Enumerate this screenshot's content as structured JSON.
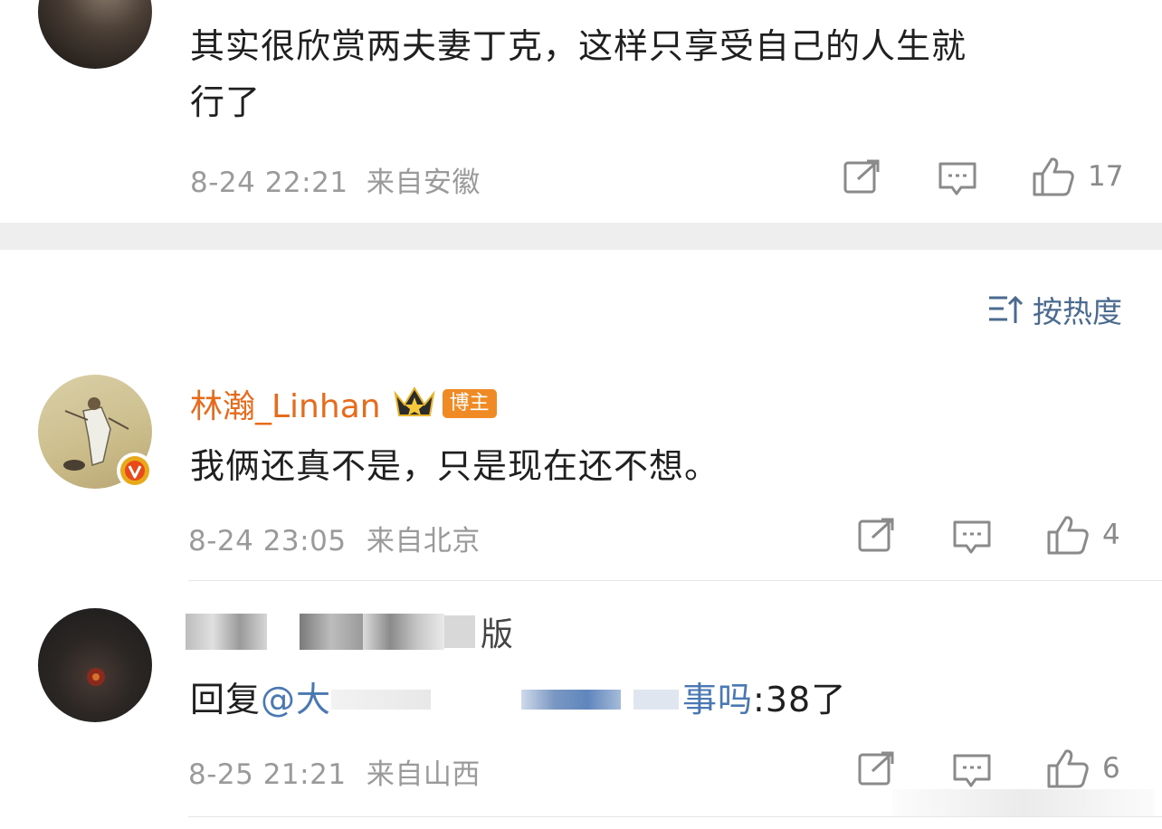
{
  "comments": [
    {
      "text_lines": [
        "其实很欣赏两夫妻丁克，这样只享受自己的人生就",
        "行了"
      ],
      "timestamp": "8-24 22:21",
      "location": "来自安徽",
      "likes": "17"
    },
    {
      "username": "林瀚_Linhan",
      "badge": "博主",
      "text": "我俩还真不是，只是现在还不想。",
      "timestamp": "8-24 23:05",
      "location": "来自北京",
      "likes": "4"
    },
    {
      "username_visible_tail": "版",
      "reply_prefix": "回复",
      "mention_start": "@大",
      "mention_end": "事吗",
      "reply_body": ":38了",
      "timestamp": "8-25 21:21",
      "location": "来自山西",
      "likes": "6"
    }
  ],
  "sort": {
    "label": "按热度"
  },
  "icons": [
    "share-icon",
    "comment-icon",
    "like-icon",
    "sort-icon",
    "crown-icon",
    "verified-icon"
  ],
  "colors": {
    "username": "#e86b1c",
    "badge": "#f08a24",
    "mention": "#4a78b3",
    "sort": "#4a6a8f",
    "verified": "#e8a91a"
  }
}
